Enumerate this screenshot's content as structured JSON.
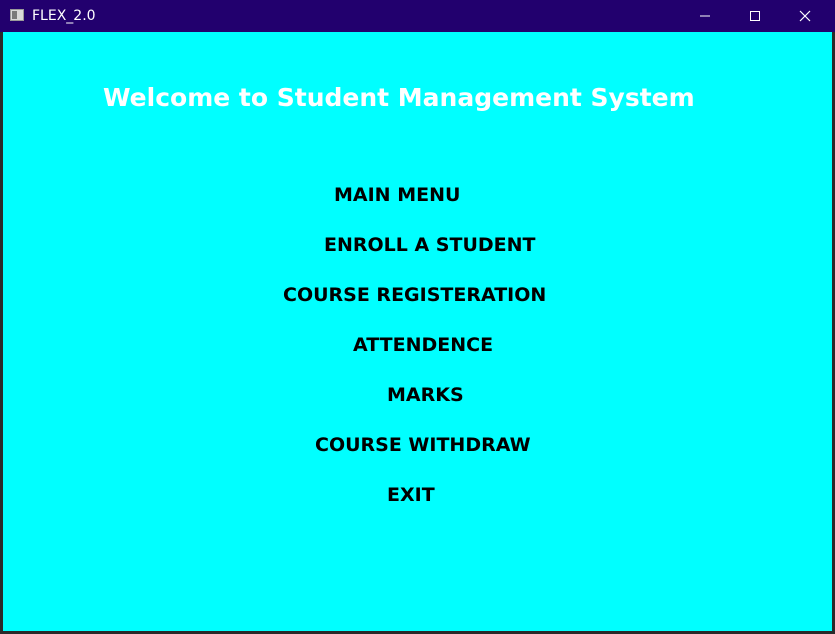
{
  "window": {
    "title": "FLEX_2.0",
    "colors": {
      "titlebar": "#22006e",
      "background": "#00ffff",
      "heading": "#ffffff",
      "menu_text": "#000000"
    },
    "icons": {
      "app": "app-icon",
      "minimize": "minimize-icon",
      "maximize": "maximize-icon",
      "close": "close-icon"
    }
  },
  "main": {
    "welcome": "Welcome to Student Management System",
    "menu_title": "MAIN MENU",
    "items": [
      "ENROLL A STUDENT",
      "COURSE REGISTERATION",
      "ATTENDENCE",
      "MARKS",
      "COURSE WITHDRAW",
      "EXIT"
    ]
  }
}
